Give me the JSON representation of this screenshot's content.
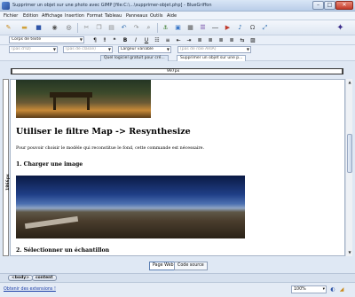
{
  "window": {
    "title": "Supprimer un objet sur une photo avec GIMP [file:C:\\...\\supprimer-objet.php] - BlueGriffon",
    "min_label": "–",
    "max_label": "□",
    "close_label": "✕"
  },
  "menubar": {
    "items": [
      "Fichier",
      "Edition",
      "Affichage",
      "Insertion",
      "Format",
      "Tableau",
      "Panneaux",
      "Outils",
      "Aide"
    ]
  },
  "format_bar": {
    "paragraph_style": "Corps de texte",
    "bold_label": "B",
    "italic_label": "I",
    "underline_label": "U"
  },
  "attribute_bar": {
    "id_select": "(pas d'ID)",
    "class_select": "(pas de classe)",
    "width_select": "Largeur variable",
    "aria_select": "(pas de rôle ARIA)"
  },
  "tabs": [
    {
      "label": "Quel logiciel gratuit pour cré...",
      "active": false
    },
    {
      "label": "Supprimer un objet sur une p...",
      "active": true
    }
  ],
  "ruler": {
    "width_label": "997px"
  },
  "left_ruler": {
    "height_label": "1866px"
  },
  "document": {
    "heading": "Utiliser le filtre Map -> Resynthesize",
    "paragraph": "Pour pouvoir choisir le modèle qui reconstitue le fond, cette commande est nécessaire.",
    "step1": "1. Charger une image",
    "step2": "2. Sélectionner un échantillon"
  },
  "view_modes": {
    "wysiwyg": "Page Web",
    "source": "Code source"
  },
  "breadcrumb": [
    "<body>",
    "content"
  ],
  "statusbar": {
    "extensions_link": "Obtenir des extensions !",
    "zoom": "100%",
    "zoom_arrow": "▾"
  },
  "colors": {
    "accent": "#2b4f9b",
    "link": "#1c3fa8",
    "close": "#c43b2a"
  }
}
